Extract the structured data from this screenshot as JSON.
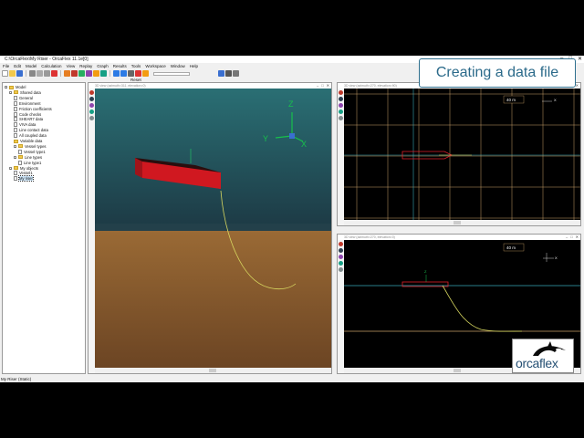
{
  "window": {
    "title": "C:\\OrcaFlex\\My Riser - OrcaFlex 11.1e[0]",
    "controls": [
      "–",
      "□",
      "✕"
    ]
  },
  "menu": [
    "File",
    "Edit",
    "Model",
    "Calculation",
    "View",
    "Replay",
    "Graph",
    "Results",
    "Tools",
    "Workspace",
    "Window",
    "Help"
  ],
  "toolbar": {
    "status_text": "Reset"
  },
  "tree": {
    "items": [
      {
        "label": "Model",
        "level": 0,
        "kind": "folder",
        "expander": "−"
      },
      {
        "label": "Shared data",
        "level": 1,
        "kind": "folder",
        "expander": "−"
      },
      {
        "label": "General",
        "level": 2,
        "kind": "doc"
      },
      {
        "label": "Environment",
        "level": 2,
        "kind": "doc"
      },
      {
        "label": "Friction coefficients",
        "level": 2,
        "kind": "doc"
      },
      {
        "label": "Code checks",
        "level": 2,
        "kind": "doc"
      },
      {
        "label": "SHEAR7 data",
        "level": 2,
        "kind": "doc"
      },
      {
        "label": "VIVA data",
        "level": 2,
        "kind": "doc"
      },
      {
        "label": "Line contact data",
        "level": 2,
        "kind": "doc"
      },
      {
        "label": "All coupled data",
        "level": 2,
        "kind": "doc"
      },
      {
        "label": "Variable data",
        "level": 2,
        "kind": "folder"
      },
      {
        "label": "Vessel types",
        "level": 2,
        "kind": "folder",
        "expander": "−"
      },
      {
        "label": "Vessel type1",
        "level": 3,
        "kind": "doc"
      },
      {
        "label": "Line types",
        "level": 2,
        "kind": "folder",
        "expander": "−"
      },
      {
        "label": "Line type1",
        "level": 3,
        "kind": "doc"
      },
      {
        "label": "My objects",
        "level": 1,
        "kind": "folder",
        "expander": "−"
      },
      {
        "label": "Vessel1",
        "level": 2,
        "kind": "doc"
      },
      {
        "label": "My riser",
        "level": 2,
        "kind": "doc",
        "selected": true
      }
    ]
  },
  "statusbar": {
    "text": "My Riser (Static)"
  },
  "views": {
    "main": {
      "title": "3D view (azimuth=311, elevation=0)"
    },
    "top": {
      "title": "3D view (azimuth=270, elevation=90)",
      "scale": "40 m"
    },
    "side": {
      "title": "3D view (azimuth=270, elevation=0)",
      "scale": "40 m"
    }
  },
  "axes": {
    "x": "X",
    "y": "Y",
    "z": "Z"
  },
  "overlay": {
    "title": "Creating a data file"
  },
  "logo": {
    "text": "orcaflex"
  },
  "colors": {
    "vessel": "#e0202a",
    "line": "#d8d860",
    "grid": "#c8a068",
    "water": "#38a8b8",
    "seabed": "#8b5a2b"
  }
}
